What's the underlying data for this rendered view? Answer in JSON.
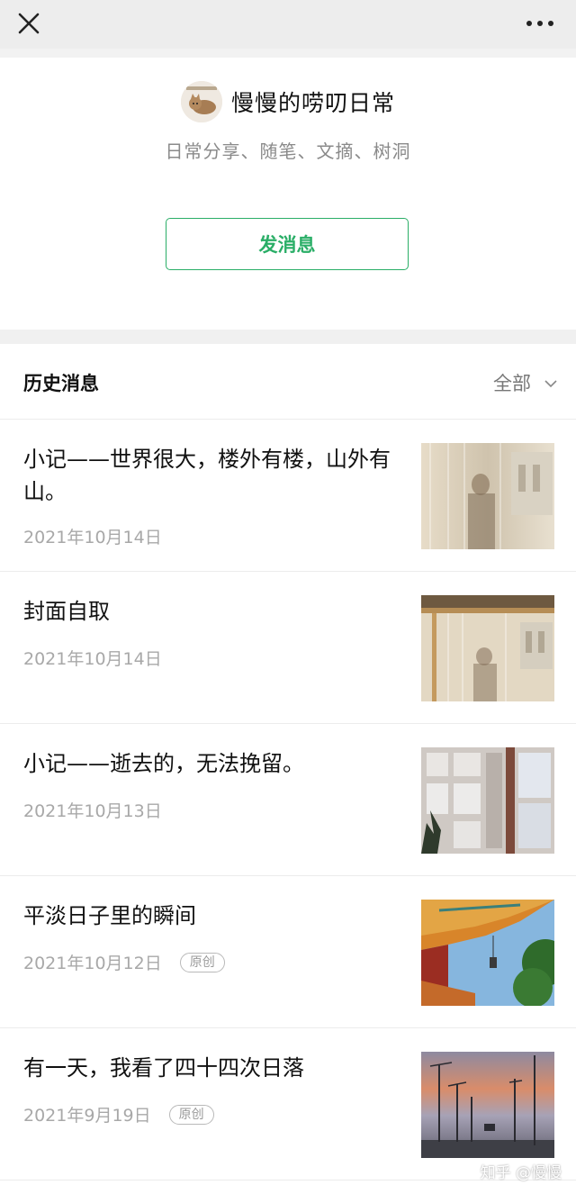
{
  "account": {
    "name": "慢慢的唠叨日常",
    "description": "日常分享、随笔、文摘、树洞",
    "avatar_icon": "cat-avatar-icon"
  },
  "actions": {
    "send_message_label": "发消息"
  },
  "history": {
    "title": "历史消息",
    "filter_label": "全部",
    "items": [
      {
        "title": "小记——世界很大，楼外有楼，山外有山。",
        "date": "2021年10月14日",
        "badge": ""
      },
      {
        "title": "封面自取",
        "date": "2021年10月14日",
        "badge": ""
      },
      {
        "title": "小记——逝去的，无法挽留。",
        "date": "2021年10月13日",
        "badge": ""
      },
      {
        "title": "平淡日子里的瞬间",
        "date": "2021年10月12日",
        "badge": "原创"
      },
      {
        "title": "有一天，我看了四十四次日落",
        "date": "2021年9月19日",
        "badge": "原创"
      }
    ]
  },
  "watermark": "知乎 @慢慢",
  "colors": {
    "accent": "#2aae67",
    "topbar": "#ededed"
  }
}
